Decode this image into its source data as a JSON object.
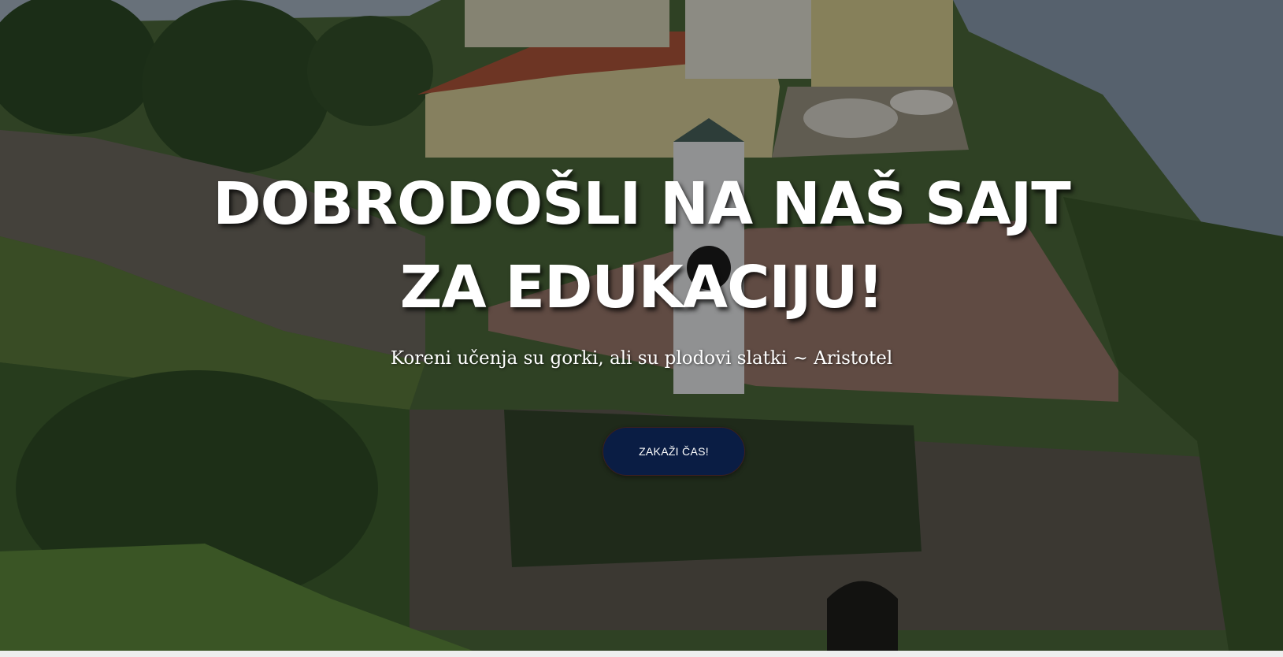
{
  "hero": {
    "title_line1": "DOBRODOŠLI NA NAŠ SAJT",
    "title_line2": "ZA EDUKACIJU!",
    "subtitle": "Koreni učenja su gorki, ali su plodovi slatki ~ Aristotel",
    "cta_label": "ZAKAŽI ČAS!",
    "background_image": "aerial photo of fortress with clock tower and river"
  },
  "colors": {
    "title": "#ffffff",
    "cta_background": "#0a1d44",
    "cta_text": "#ffffff",
    "overlay": "#000000"
  }
}
